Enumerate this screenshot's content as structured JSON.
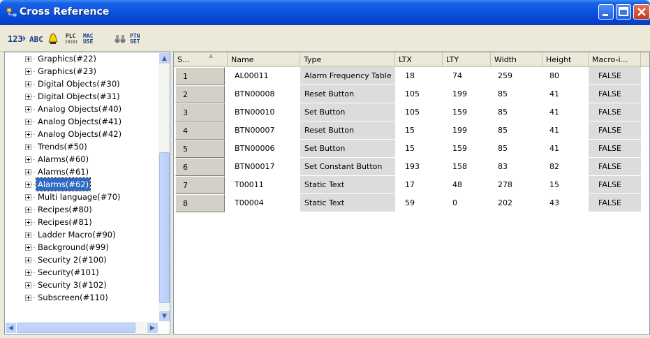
{
  "window": {
    "title": "Cross Reference"
  },
  "colors": {
    "titlebar": "#0a55e0",
    "selection": "#316ac5",
    "grid_gray": "#dcdcdc"
  },
  "toolbar": {
    "buttons": [
      {
        "icon": "numbering-icon"
      },
      {
        "icon": "text-abc-icon"
      },
      {
        "icon": "alarm-bell-icon"
      },
      {
        "icon": "plc-io-icon"
      },
      {
        "icon": "mac-use-icon"
      },
      {
        "icon": "find-binoculars-icon"
      },
      {
        "icon": "ptn-set-icon"
      }
    ],
    "plc_top": "PLC",
    "plc_bottom": "I0I0I",
    "mac_top": "MAC",
    "mac_bottom": "USE",
    "ptn_top": "PTN",
    "ptn_bottom": "SET",
    "abc": "ABC"
  },
  "tree": {
    "items": [
      {
        "label": "Graphics(#22)"
      },
      {
        "label": "Graphics(#23)"
      },
      {
        "label": "Digital Objects(#30)"
      },
      {
        "label": "Digital Objects(#31)"
      },
      {
        "label": "Analog Objects(#40)"
      },
      {
        "label": "Analog Objects(#41)"
      },
      {
        "label": "Analog Objects(#42)"
      },
      {
        "label": "Trends(#50)"
      },
      {
        "label": "Alarms(#60)"
      },
      {
        "label": "Alarms(#61)"
      },
      {
        "label": "Alarms(#62)",
        "selected": true
      },
      {
        "label": "Multi language(#70)"
      },
      {
        "label": "Recipes(#80)"
      },
      {
        "label": "Recipes(#81)"
      },
      {
        "label": "Ladder Macro(#90)"
      },
      {
        "label": "Background(#99)"
      },
      {
        "label": "Security 2(#100)"
      },
      {
        "label": "Security(#101)"
      },
      {
        "label": "Security 3(#102)"
      },
      {
        "label": "Subscreen(#110)"
      }
    ]
  },
  "table": {
    "columns": [
      "S...",
      "Name",
      "Type",
      "LTX",
      "LTY",
      "Width",
      "Height",
      "Macro-i..."
    ],
    "rows": [
      [
        "1",
        "AL00011",
        "Alarm Frequency Table",
        "18",
        "74",
        "259",
        "80",
        "FALSE"
      ],
      [
        "2",
        "BTN00008",
        "Reset Button",
        "105",
        "199",
        "85",
        "41",
        "FALSE"
      ],
      [
        "3",
        "BTN00010",
        "Set Button",
        "105",
        "159",
        "85",
        "41",
        "FALSE"
      ],
      [
        "4",
        "BTN00007",
        "Reset Button",
        "15",
        "199",
        "85",
        "41",
        "FALSE"
      ],
      [
        "5",
        "BTN00006",
        "Set Button",
        "15",
        "159",
        "85",
        "41",
        "FALSE"
      ],
      [
        "6",
        "BTN00017",
        "Set Constant Button",
        "193",
        "158",
        "83",
        "82",
        "FALSE"
      ],
      [
        "7",
        "T00011",
        "Static Text",
        "17",
        "48",
        "278",
        "15",
        "FALSE"
      ],
      [
        "8",
        "T00004",
        "Static Text",
        "59",
        "0",
        "202",
        "43",
        "FALSE"
      ]
    ]
  }
}
